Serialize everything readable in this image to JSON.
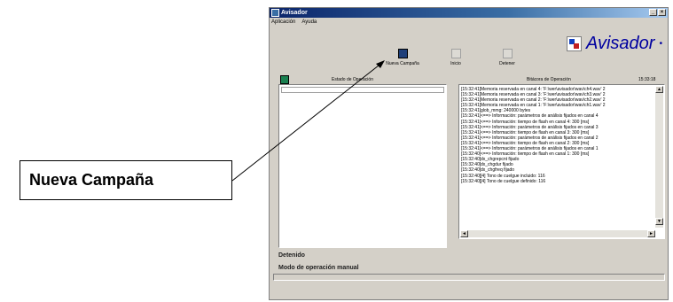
{
  "window": {
    "title": "Avisador"
  },
  "menu": [
    "Aplicación",
    "Ayuda"
  ],
  "toolbar": [
    {
      "label": "Nueva Campaña",
      "icon": "save-icon"
    },
    {
      "label": "Inicio",
      "icon": "start-icon"
    },
    {
      "label": "Detener",
      "icon": "stop-icon"
    }
  ],
  "logo": {
    "text": "Avisador",
    "suffix": "•"
  },
  "estado": {
    "header": "Estado de Operación"
  },
  "bitacora": {
    "header": "Bitácora de Operación",
    "time": "15:33:18",
    "lines": [
      {
        "t": "[15:32:41]",
        "m": "Memoria reservada en canal 4: 'F:\\wer\\avisador\\wav\\ch4.wav' 2"
      },
      {
        "t": "[15:32:41]",
        "m": "Memoria reservada en canal 3: 'F:\\wer\\avisador\\wav\\ch3.wav' 2"
      },
      {
        "t": "[15:32:41]",
        "m": "Memoria reservada en canal 2: 'F:\\wer\\avisador\\wav\\ch2.wav' 2"
      },
      {
        "t": "[15:32:41]",
        "m": "Memoria reservada en canal 1: 'F:\\wer\\avisador\\wav\\ch1.wav' 2"
      },
      {
        "t": "[15:32:41]",
        "m": "glob_mmg: 240000 bytes"
      },
      {
        "t": "[15:32:41]",
        "m": "<==> Información: parámetros de análisis fijados en canal 4"
      },
      {
        "t": "[15:32:41]",
        "m": "<==> Información: tiempo de flash en canal 4: 300 [ms]"
      },
      {
        "t": "[15:32:41]",
        "m": "<==> Información: parámetros de análisis fijados en canal 3"
      },
      {
        "t": "[15:32:41]",
        "m": "<==> Información: tiempo de flash en canal 3: 300 [ms]"
      },
      {
        "t": "[15:32:41]",
        "m": "<==> Información: parámetros de análisis fijados en canal 2"
      },
      {
        "t": "[15:32:41]",
        "m": "<==> Información: tiempo de flash en canal 2: 300 [ms]"
      },
      {
        "t": "[15:32:41]",
        "m": "<==> Información: parámetros de análisis fijados en canal 1"
      },
      {
        "t": "[15:32:40]",
        "m": "<==> Información: tiempo de flash en canal 1: 300 [ms]"
      },
      {
        "t": "[15:32:40]",
        "m": "dx_chgrepcnt fijado"
      },
      {
        "t": "[15:32:40]",
        "m": "dx_chgdur fijado"
      },
      {
        "t": "[15:32:40]",
        "m": "dx_chgfreq fijado"
      },
      {
        "t": "[15:32:40]",
        "m": "[4] Tono de cuelgue incluido: 116"
      },
      {
        "t": "[15:32:40]",
        "m": "[4] Tono de cuelgue definido: 116"
      }
    ]
  },
  "status": {
    "state": "Detenido",
    "mode": "Modo de operación manual"
  },
  "callout": {
    "text": "Nueva Campaña"
  }
}
